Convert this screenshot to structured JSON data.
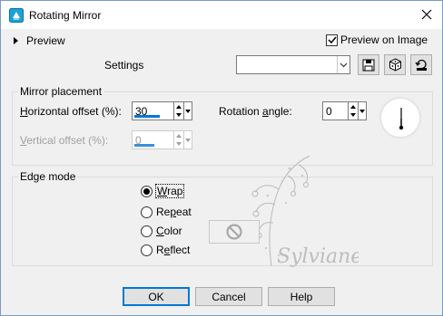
{
  "window": {
    "title": "Rotating Mirror"
  },
  "header": {
    "preview_label": "Preview",
    "preview_on_image_label": "Preview on Image",
    "preview_on_image_checked": true
  },
  "settings": {
    "label": "Settings",
    "value": "",
    "save_icon": "floppy-disk-icon",
    "randomize_icon": "dice-icon",
    "reset_icon": "reset-icon"
  },
  "mirror_placement": {
    "title": "Mirror placement",
    "horizontal_offset": {
      "label": "Horizontal offset (%):",
      "value": "30",
      "level_fraction": 0.65
    },
    "vertical_offset": {
      "label": "Vertical offset (%):",
      "value": "0",
      "level_fraction": 0.5,
      "enabled": false
    },
    "rotation_angle": {
      "label": "Rotation angle:",
      "value": "0"
    }
  },
  "edge_mode": {
    "title": "Edge mode",
    "options": [
      {
        "label": "Wrap",
        "selected": true
      },
      {
        "label": "Repeat",
        "selected": false
      },
      {
        "label": "Color",
        "selected": false
      },
      {
        "label": "Reflect",
        "selected": false
      }
    ]
  },
  "watermark": {
    "text": "Sylviane"
  },
  "buttons": {
    "ok": "OK",
    "cancel": "Cancel",
    "help": "Help"
  },
  "colors": {
    "accent": "#0078d7",
    "background": "#f0f0f0"
  }
}
